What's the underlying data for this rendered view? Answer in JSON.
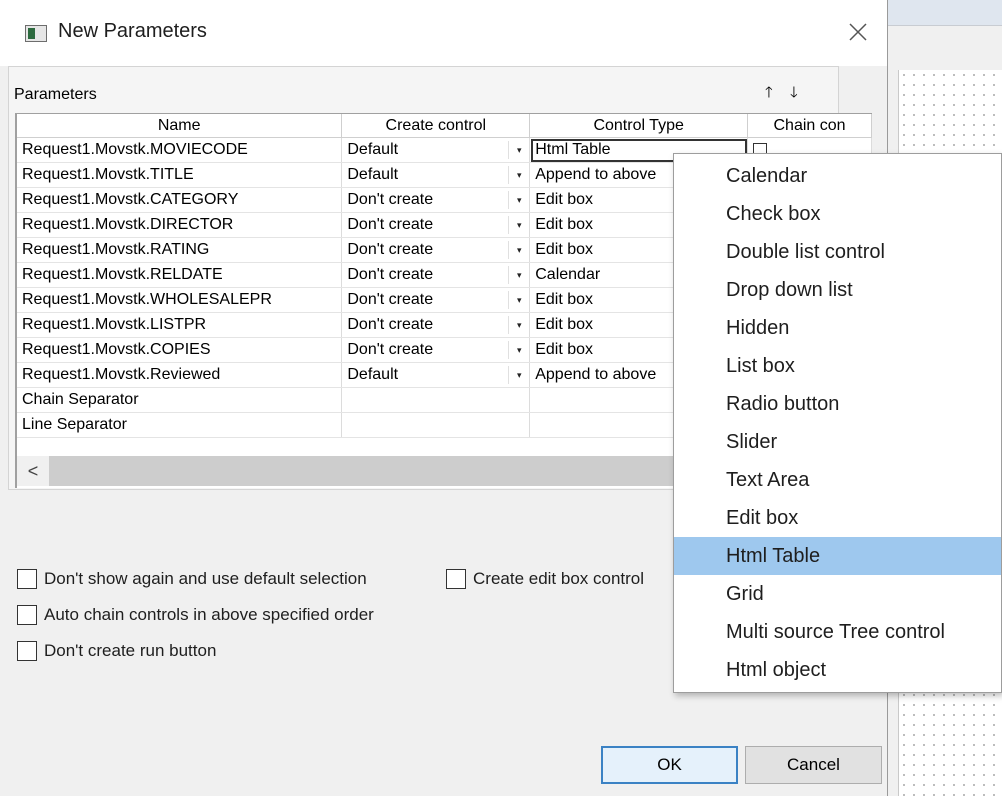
{
  "dialog": {
    "title": "New Parameters",
    "ok_label": "OK",
    "cancel_label": "Cancel"
  },
  "panel": {
    "label": "Parameters"
  },
  "grid": {
    "columns": [
      "Name",
      "Create control",
      "Control Type",
      "Chain con"
    ],
    "rows": [
      {
        "name": "Request1.Movstk.MOVIECODE",
        "create": "Default",
        "type": "Html Table",
        "active": true
      },
      {
        "name": "Request1.Movstk.TITLE",
        "create": "Default",
        "type": "Append to above"
      },
      {
        "name": "Request1.Movstk.CATEGORY",
        "create": "Don't create",
        "type": "Edit box"
      },
      {
        "name": "Request1.Movstk.DIRECTOR",
        "create": "Don't create",
        "type": "Edit box"
      },
      {
        "name": "Request1.Movstk.RATING",
        "create": "Don't create",
        "type": "Edit box"
      },
      {
        "name": "Request1.Movstk.RELDATE",
        "create": "Don't create",
        "type": "Calendar"
      },
      {
        "name": "Request1.Movstk.WHOLESALEPR",
        "create": "Don't create",
        "type": "Edit box"
      },
      {
        "name": "Request1.Movstk.LISTPR",
        "create": "Don't create",
        "type": "Edit box"
      },
      {
        "name": "Request1.Movstk.COPIES",
        "create": "Don't create",
        "type": "Edit box"
      },
      {
        "name": "Request1.Movstk.Reviewed",
        "create": "Default",
        "type": "Append to above"
      },
      {
        "name": "Chain Separator",
        "create": "",
        "type": ""
      },
      {
        "name": "Line Separator",
        "create": "",
        "type": ""
      }
    ]
  },
  "options": {
    "dont_show_again": "Don't show again and use default selection",
    "create_edit_box": "Create edit box control",
    "auto_chain": "Auto chain controls in above specified order",
    "dont_create_run": "Don't create run button"
  },
  "dropdown": {
    "items": [
      "Calendar",
      "Check box",
      "Double list control",
      "Drop down list",
      "Hidden",
      "List box",
      "Radio button",
      "Slider",
      "Text Area",
      "Edit box",
      "Html Table",
      "Grid",
      "Multi source Tree control",
      "Html object"
    ],
    "selected": "Html Table"
  },
  "colors": {
    "selection": "#9ec8ee",
    "ok_border": "#3b82c4"
  }
}
